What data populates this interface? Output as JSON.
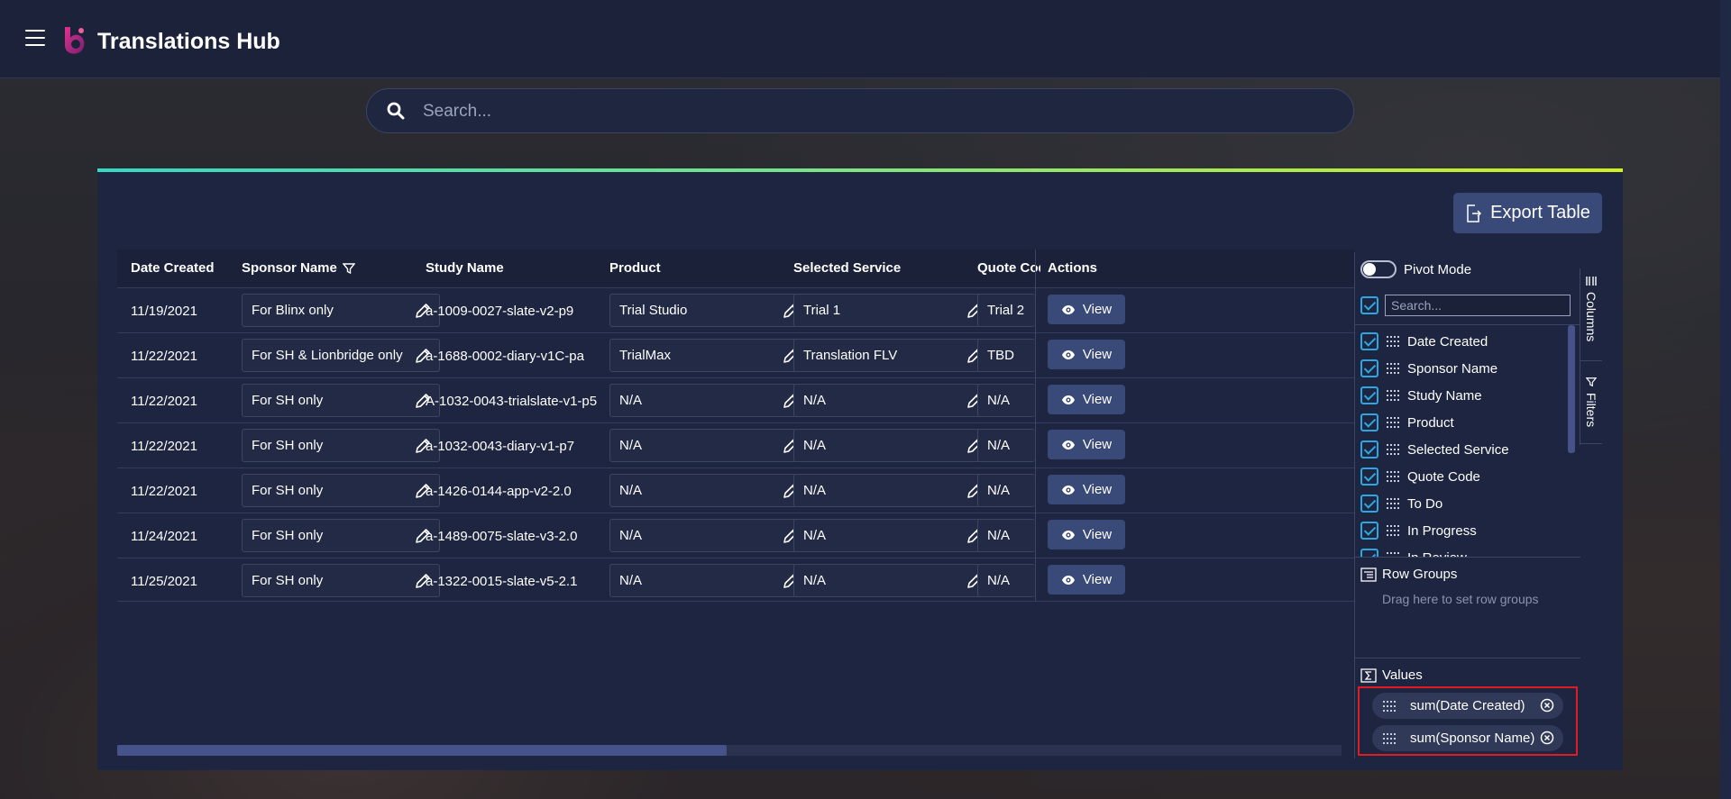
{
  "app": {
    "title": "Translations Hub"
  },
  "search": {
    "placeholder": "Search..."
  },
  "toolbar": {
    "export_label": "Export Table"
  },
  "table": {
    "headers": {
      "date_created": "Date Created",
      "sponsor_name": "Sponsor Name",
      "study_name": "Study Name",
      "product": "Product",
      "selected_service": "Selected Service",
      "quote_code": "Quote Code",
      "actions": "Actions"
    },
    "view_label": "View",
    "rows": [
      {
        "date": "11/19/2021",
        "sponsor": "For  Blinx only",
        "study": "a-1009-0027-slate-v2-p9",
        "product": "Trial Studio",
        "service": "Trial 1",
        "quote": "Trial 2"
      },
      {
        "date": "11/22/2021",
        "sponsor": "For SH & Lionbridge only",
        "study": "a-1688-0002-diary-v1C-pa",
        "product": "TrialMax",
        "service": "Translation FLV",
        "quote": "TBD"
      },
      {
        "date": "11/22/2021",
        "sponsor": "For SH only",
        "study": "A-1032-0043-trialslate-v1-p5",
        "product": "N/A",
        "service": "N/A",
        "quote": "N/A"
      },
      {
        "date": "11/22/2021",
        "sponsor": "For SH only",
        "study": "a-1032-0043-diary-v1-p7",
        "product": "N/A",
        "service": "N/A",
        "quote": "N/A"
      },
      {
        "date": "11/22/2021",
        "sponsor": "For SH only",
        "study": "a-1426-0144-app-v2-2.0",
        "product": "N/A",
        "service": "N/A",
        "quote": "N/A"
      },
      {
        "date": "11/24/2021",
        "sponsor": "For SH only",
        "study": "a-1489-0075-slate-v3-2.0",
        "product": "N/A",
        "service": "N/A",
        "quote": "N/A"
      },
      {
        "date": "11/25/2021",
        "sponsor": "For SH only",
        "study": "a-1322-0015-slate-v5-2.1",
        "product": "N/A",
        "service": "N/A",
        "quote": "N/A"
      }
    ]
  },
  "tool_panel": {
    "pivot_mode_label": "Pivot Mode",
    "filter_placeholder": "Search...",
    "columns": [
      "Date Created",
      "Sponsor Name",
      "Study Name",
      "Product",
      "Selected Service",
      "Quote Code",
      "To Do",
      "In Progress",
      "In Review"
    ],
    "row_groups": {
      "title": "Row Groups",
      "hint": "Drag here to set row groups"
    },
    "values": {
      "title": "Values",
      "items": [
        "sum(Date Created)",
        "sum(Sponsor Name)"
      ]
    },
    "tabs": {
      "columns": "Columns",
      "filters": "Filters"
    }
  },
  "colors": {
    "accent_start": "#36d7c4",
    "accent_end": "#d2ef1f",
    "checkbox": "#2ea7e0",
    "highlight_border": "#e01b22"
  }
}
